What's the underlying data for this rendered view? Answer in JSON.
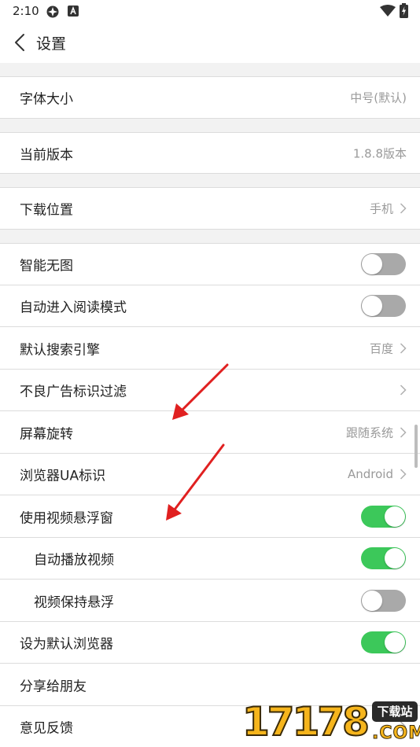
{
  "status_bar": {
    "time": "2:10",
    "icons": [
      "vpn-icon",
      "notification-a-icon",
      "wifi-icon",
      "battery-charging-icon"
    ]
  },
  "header": {
    "title": "设置",
    "back_icon": "chevron-left-icon"
  },
  "settings": {
    "font_size": {
      "label": "字体大小",
      "value": "中号(默认)"
    },
    "version": {
      "label": "当前版本",
      "value": "1.8.8版本"
    },
    "download_location": {
      "label": "下载位置",
      "value": "手机"
    },
    "smart_no_image": {
      "label": "智能无图",
      "enabled": false
    },
    "auto_reading_mode": {
      "label": "自动进入阅读模式",
      "enabled": false
    },
    "default_search_engine": {
      "label": "默认搜索引擎",
      "value": "百度"
    },
    "ad_filter": {
      "label": "不良广告标识过滤"
    },
    "screen_rotation": {
      "label": "屏幕旋转",
      "value": "跟随系统"
    },
    "browser_ua": {
      "label": "浏览器UA标识",
      "value": "Android"
    },
    "floating_video": {
      "label": "使用视频悬浮窗",
      "enabled": true
    },
    "autoplay_video": {
      "label": "自动播放视频",
      "enabled": true
    },
    "keep_video_floating": {
      "label": "视频保持悬浮",
      "enabled": false
    },
    "set_default_browser": {
      "label": "设为默认浏览器",
      "enabled": true
    },
    "share": {
      "label": "分享给朋友"
    },
    "feedback": {
      "label": "意见反馈"
    }
  },
  "annotation": {
    "arrow_color": "#e02020"
  },
  "watermark": {
    "number": "17178",
    "badge": "下载站",
    "domain": ".COM"
  },
  "colors": {
    "toggle_on": "#3cc85a",
    "toggle_off": "#a9a9a9",
    "value_text": "#9a9a9a",
    "background": "#f2f2f2"
  }
}
